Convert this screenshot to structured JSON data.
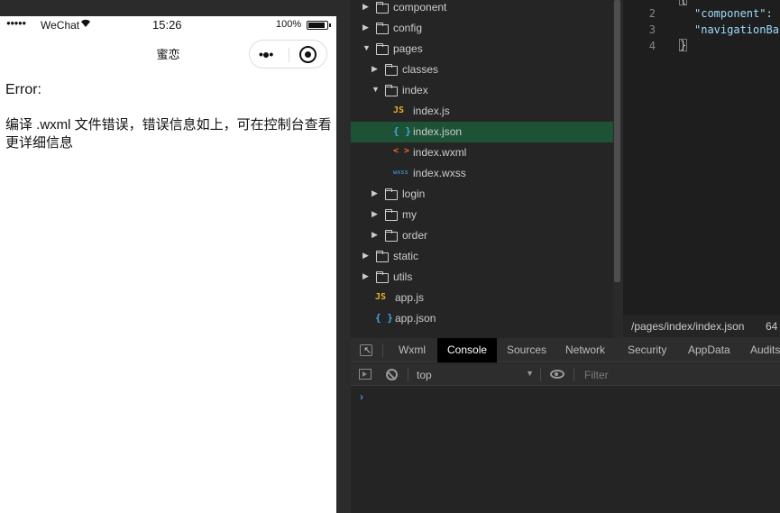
{
  "simulator": {
    "status_bar": {
      "signal": "●●●●●",
      "carrier": "WeChat",
      "wifi": "wifi-icon",
      "time": "15:26",
      "battery_pct": "100%"
    },
    "nav": {
      "title": "蜜恋",
      "more_icon": "•●•",
      "close_icon": "record-icon"
    },
    "error_title": "Error:",
    "error_message": "编译 .wxml 文件错误，错误信息如上，可在控制台查看更详细信息"
  },
  "file_tree": {
    "items": [
      {
        "label": "component",
        "type": "folder",
        "expanded": false
      },
      {
        "label": "config",
        "type": "folder",
        "expanded": false
      },
      {
        "label": "pages",
        "type": "folder",
        "expanded": true
      },
      {
        "label": "classes",
        "type": "folder",
        "expanded": false
      },
      {
        "label": "index",
        "type": "folder",
        "expanded": true
      },
      {
        "label": "index.js",
        "type": "js"
      },
      {
        "label": "index.json",
        "type": "json",
        "selected": true
      },
      {
        "label": "index.wxml",
        "type": "wxml"
      },
      {
        "label": "index.wxss",
        "type": "wxss"
      },
      {
        "label": "login",
        "type": "folder",
        "expanded": false
      },
      {
        "label": "my",
        "type": "folder",
        "expanded": false
      },
      {
        "label": "order",
        "type": "folder",
        "expanded": false
      },
      {
        "label": "static",
        "type": "folder",
        "expanded": false
      },
      {
        "label": "utils",
        "type": "folder",
        "expanded": false
      },
      {
        "label": "app.js",
        "type": "js"
      },
      {
        "label": "app.json",
        "type": "json"
      }
    ],
    "icon_text": {
      "js": "JS",
      "json": "{ }",
      "wxml": "< >",
      "wxss": "wxss"
    }
  },
  "editor": {
    "lines": [
      {
        "num": "2",
        "text": "\"component\":"
      },
      {
        "num": "3",
        "text": "\"navigationBa"
      },
      {
        "num": "4",
        "text": "}"
      }
    ],
    "status_path": "/pages/index/index.json",
    "status_num": "64"
  },
  "devtools": {
    "tabs": [
      "Wxml",
      "Console",
      "Sources",
      "Network",
      "Security",
      "AppData",
      "Audits"
    ],
    "active_tab": "Console",
    "context": "top",
    "filter_placeholder": "Filter",
    "prompt": "›"
  },
  "colors": {
    "selected_row": "#1e5236",
    "js_icon": "#e8b32b",
    "json_icon": "#3ea8e6",
    "wxml_icon": "#e9692c",
    "code_key": "#9cdcfe"
  }
}
